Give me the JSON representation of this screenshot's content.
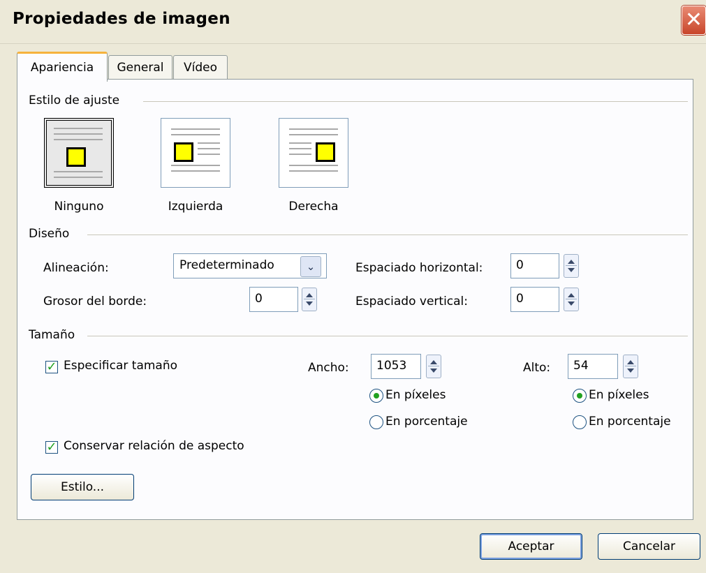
{
  "window": {
    "title": "Propiedades de imagen",
    "close_icon": "close-icon"
  },
  "tabs": [
    {
      "label": "Apariencia",
      "active": true
    },
    {
      "label": "General",
      "active": false
    },
    {
      "label": "Vídeo",
      "active": false
    }
  ],
  "wrap": {
    "heading": "Estilo de ajuste",
    "options": [
      {
        "label": "Ninguno",
        "selected": true
      },
      {
        "label": "Izquierda",
        "selected": false
      },
      {
        "label": "Derecha",
        "selected": false
      }
    ]
  },
  "design": {
    "heading": "Diseño",
    "alignment_label": "Alineación:",
    "alignment_value": "Predeterminado",
    "border_label": "Grosor del borde:",
    "border_value": "0",
    "hspace_label": "Espaciado horizontal:",
    "hspace_value": "0",
    "vspace_label": "Espaciado vertical:",
    "vspace_value": "0"
  },
  "size": {
    "heading": "Tamaño",
    "specify_label": "Especificar tamaño",
    "specify_checked": true,
    "width_label": "Ancho:",
    "width_value": "1053",
    "height_label": "Alto:",
    "height_value": "54",
    "pixels_label": "En píxeles",
    "percent_label": "En porcentaje",
    "keep_ratio_label": "Conservar relación de aspecto",
    "keep_ratio_checked": true
  },
  "buttons": {
    "style": "Estilo...",
    "ok": "Aceptar",
    "cancel": "Cancelar"
  }
}
